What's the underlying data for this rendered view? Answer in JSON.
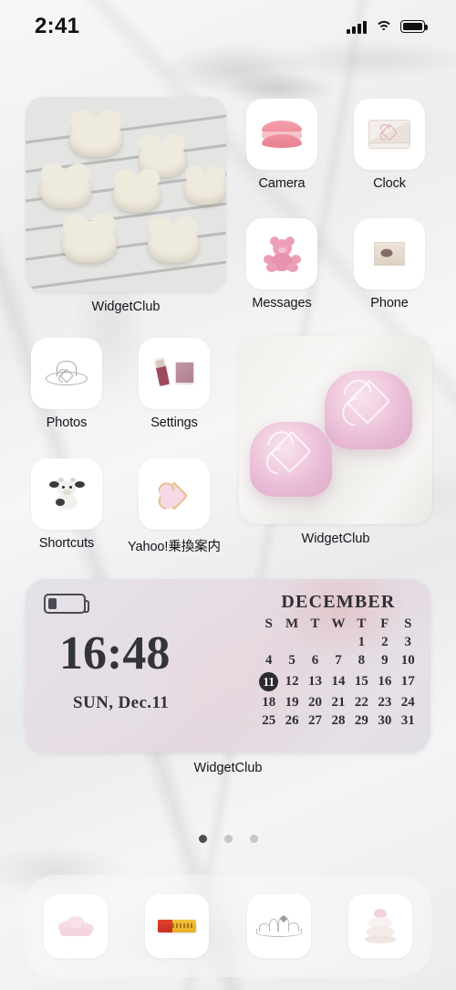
{
  "status_bar": {
    "time": "2:41",
    "signal_icon": "cellular-bars-icon",
    "wifi_icon": "wifi-icon",
    "battery_icon": "battery-full-icon"
  },
  "home_screen": {
    "widgets": [
      {
        "name": "widget-photo-cookies",
        "label": "WidgetClub",
        "image_description": "cloud-shaped white cookies on a cooling rack"
      },
      {
        "name": "widget-photo-airpods",
        "label": "WidgetClub",
        "image_description": "two pink heart-pattern AirPods cases"
      },
      {
        "name": "widget-clock-calendar",
        "label": "WidgetClub",
        "clock": {
          "time": "16:48",
          "date": "SUN, Dec.11",
          "battery_icon": "battery-low-icon"
        },
        "calendar": {
          "month": "DECEMBER",
          "weekday_headers": [
            "S",
            "M",
            "T",
            "W",
            "T",
            "F",
            "S"
          ],
          "weeks": [
            [
              "",
              "",
              "",
              "",
              "1",
              "2",
              "3"
            ],
            [
              "4",
              "5",
              "6",
              "7",
              "8",
              "9",
              "10"
            ],
            [
              "11",
              "12",
              "13",
              "14",
              "15",
              "16",
              "17"
            ],
            [
              "18",
              "19",
              "20",
              "21",
              "22",
              "23",
              "24"
            ],
            [
              "25",
              "26",
              "27",
              "28",
              "29",
              "30",
              "31"
            ]
          ],
          "today": "11"
        }
      }
    ],
    "apps": [
      {
        "name": "camera",
        "label": "Camera",
        "icon": "macaron-icon"
      },
      {
        "name": "clock",
        "label": "Clock",
        "icon": "envelope-icon"
      },
      {
        "name": "messages",
        "label": "Messages",
        "icon": "teddy-bear-icon"
      },
      {
        "name": "phone",
        "label": "Phone",
        "icon": "photo-thumbnail-icon"
      },
      {
        "name": "photos",
        "label": "Photos",
        "icon": "heart-hat-outline-icon"
      },
      {
        "name": "settings",
        "label": "Settings",
        "icon": "lipstick-compact-icon"
      },
      {
        "name": "shortcuts",
        "label": "Shortcuts",
        "icon": "cow-plush-icon"
      },
      {
        "name": "yahoo-transit",
        "label": "Yahoo!乗換案内",
        "icon": "heart-cookie-icon"
      }
    ],
    "page_indicator": {
      "total": 3,
      "current": 1
    },
    "dock": [
      {
        "name": "dock-app-1",
        "icon": "cotton-candy-cloud-icon"
      },
      {
        "name": "dock-app-2",
        "icon": "gum-package-icon"
      },
      {
        "name": "dock-app-3",
        "icon": "tiara-icon"
      },
      {
        "name": "dock-app-4",
        "icon": "stacked-macarons-icon"
      }
    ]
  },
  "theme": {
    "wallpaper": "white-marble",
    "accent_color": "#eb9fb5",
    "widget_tint": "#dedce8",
    "label_color": "#15151a"
  }
}
